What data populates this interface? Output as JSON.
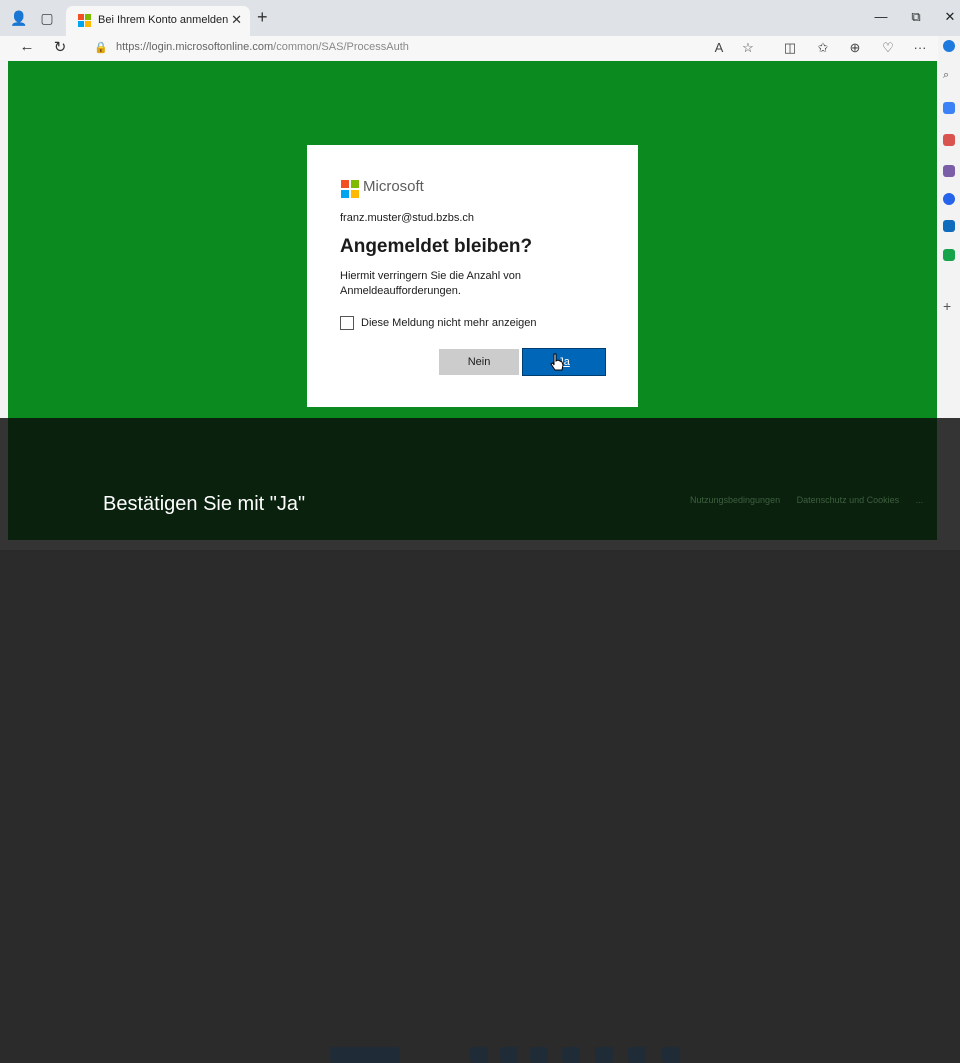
{
  "browser": {
    "tab_title": "Bei Ihrem Konto anmelden",
    "url_host": "https://login.microsoftonline.com",
    "url_path": "/common/SAS/ProcessAuth",
    "icons": [
      "profile-icon",
      "tab-actions-icon",
      "back-icon",
      "refresh-icon",
      "lock-icon",
      "read-aloud-icon",
      "favorite-icon",
      "split-screen-icon",
      "favorites-icon",
      "collections-icon",
      "heart-icon",
      "more-icon",
      "copilot-icon",
      "minimize-icon",
      "restore-icon",
      "close-icon"
    ]
  },
  "dialog": {
    "brand": "Microsoft",
    "email": "franz.muster@stud.bzbs.ch",
    "heading": "Angemeldet bleiben?",
    "description": "Hiermit verringern Sie die Anzahl von Anmeldeaufforderungen.",
    "checkbox_label": "Diese Meldung nicht mehr anzeigen",
    "checkbox_checked": false,
    "no_button": "Nein",
    "yes_button": "Ja"
  },
  "footer": {
    "links": [
      "Nutzungsbedingungen",
      "Datenschutz und Cookies",
      "..."
    ]
  },
  "caption": "Bestätigen Sie mit \"Ja\"",
  "colors": {
    "page_bg": "#0a8a1f",
    "primary_button": "#0067b8",
    "ms_red": "#f25022",
    "ms_green": "#7fba00",
    "ms_blue": "#00a4ef",
    "ms_yellow": "#ffb900"
  }
}
